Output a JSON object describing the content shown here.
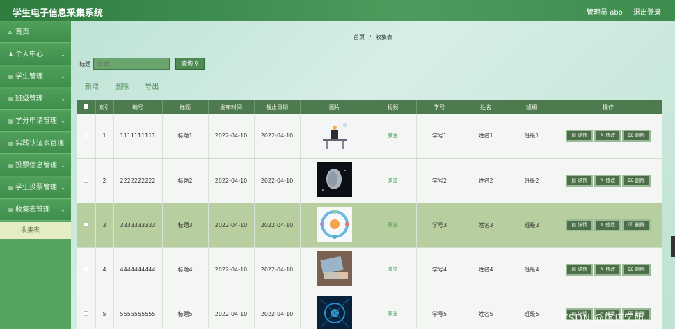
{
  "app": {
    "title": "学生电子信息采集系统",
    "user": "管理员 abo",
    "logout": "退出登录"
  },
  "sidebar": {
    "items": [
      {
        "label": "首页",
        "icon": "home-icon",
        "glyph": "⌂"
      },
      {
        "label": "个人中心",
        "icon": "user-icon",
        "glyph": "♟"
      },
      {
        "label": "学生管理",
        "icon": "list-icon",
        "glyph": "▤"
      },
      {
        "label": "班级管理",
        "icon": "list-icon",
        "glyph": "▤"
      },
      {
        "label": "学分申请管理",
        "icon": "list-icon",
        "glyph": "▤"
      },
      {
        "label": "实践认证表管理",
        "icon": "list-icon",
        "glyph": "▤"
      },
      {
        "label": "投票信息管理",
        "icon": "list-icon",
        "glyph": "▤"
      },
      {
        "label": "学生投票管理",
        "icon": "list-icon",
        "glyph": "▤"
      },
      {
        "label": "收集表管理",
        "icon": "list-icon",
        "glyph": "▤"
      }
    ],
    "submenu": "收集表"
  },
  "breadcrumb": {
    "home": "首页",
    "sep": "/",
    "current": "收集表"
  },
  "search": {
    "label": "标题",
    "placeholder": "标题",
    "button": "查询",
    "button_icon": "search-icon"
  },
  "actions": {
    "add": "新增",
    "delete": "删除",
    "export": "导出"
  },
  "table": {
    "headers": [
      "索引",
      "编号",
      "标题",
      "发布时间",
      "截止日期",
      "图片",
      "视频",
      "学号",
      "姓名",
      "班级",
      "操作"
    ],
    "rows": [
      {
        "index": "1",
        "code": "1111111111",
        "title": "标题1",
        "publish": "2022-04-10",
        "deadline": "2022-04-10",
        "video": "预览",
        "student_no": "学号1",
        "name": "姓名1",
        "class": "班级1"
      },
      {
        "index": "2",
        "code": "2222222222",
        "title": "标题2",
        "publish": "2022-04-10",
        "deadline": "2022-04-10",
        "video": "预览",
        "student_no": "学号2",
        "name": "姓名2",
        "class": "班级2"
      },
      {
        "index": "3",
        "code": "3333333333",
        "title": "标题3",
        "publish": "2022-04-10",
        "deadline": "2022-04-10",
        "video": "预览",
        "student_no": "学号3",
        "name": "姓名3",
        "class": "班级3"
      },
      {
        "index": "4",
        "code": "4444444444",
        "title": "标题4",
        "publish": "2022-04-10",
        "deadline": "2022-04-10",
        "video": "预览",
        "student_no": "学号4",
        "name": "姓名4",
        "class": "班级4"
      },
      {
        "index": "5",
        "code": "5555555555",
        "title": "标题5",
        "publish": "2022-04-10",
        "deadline": "2022-04-10",
        "video": "预览",
        "student_no": "学号5",
        "name": "姓名5",
        "class": "班级5"
      }
    ],
    "ops": {
      "detail": "详情",
      "edit": "修改",
      "delete": "删除"
    },
    "highlight_row": 2
  },
  "watermark": "CSDN @琪琪学姐",
  "colors": {
    "brand": "#3d8c4e",
    "sidebar": "#55a35f",
    "header": "#4d7a4f",
    "highlight": "#b7cf9f"
  }
}
